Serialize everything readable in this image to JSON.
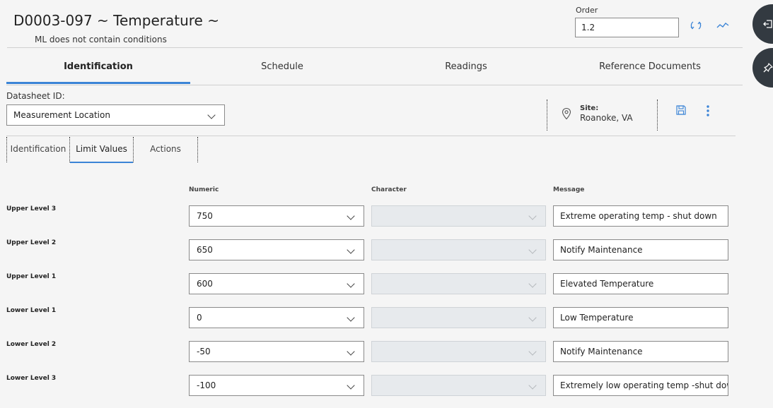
{
  "header": {
    "title": "D0003-097 ~ Temperature ~",
    "subtitle": "ML does not contain conditions",
    "order_label": "Order",
    "order_value": "1.2",
    "icons": [
      "refresh-icon",
      "trend-chart-icon"
    ]
  },
  "tabs": [
    {
      "label": "Identification",
      "active": true
    },
    {
      "label": "Schedule",
      "active": false
    },
    {
      "label": "Readings",
      "active": false
    },
    {
      "label": "Reference Documents",
      "active": false
    }
  ],
  "datasheet": {
    "label": "Datasheet ID:",
    "value": "Measurement Location"
  },
  "site": {
    "label": "Site:",
    "value": "Roanoke, VA"
  },
  "subtabs": [
    {
      "label": "Identification",
      "active": false
    },
    {
      "label": "Limit Values",
      "active": true
    },
    {
      "label": "Actions",
      "active": false
    }
  ],
  "limits": {
    "columns": {
      "numeric": "Numeric",
      "character": "Character",
      "message": "Message"
    },
    "rows": [
      {
        "label": "Upper Level 3",
        "numeric": "750",
        "character": "",
        "message": "Extreme operating temp - shut down"
      },
      {
        "label": "Upper Level 2",
        "numeric": "650",
        "character": "",
        "message": "Notify  Maintenance"
      },
      {
        "label": "Upper Level 1",
        "numeric": "600",
        "character": "",
        "message": "Elevated Temperature"
      },
      {
        "label": "Lower Level 1",
        "numeric": "0",
        "character": "",
        "message": "Low Temperature"
      },
      {
        "label": "Lower Level 2",
        "numeric": "-50",
        "character": "",
        "message": "Notify Maintenance"
      },
      {
        "label": "Lower Level 3",
        "numeric": "-100",
        "character": "",
        "message": "Extremely low operating temp -shut down"
      }
    ]
  },
  "colors": {
    "accent": "#3b84d6",
    "rail_button": "#333a41",
    "disabled_field": "#e7eaed"
  }
}
